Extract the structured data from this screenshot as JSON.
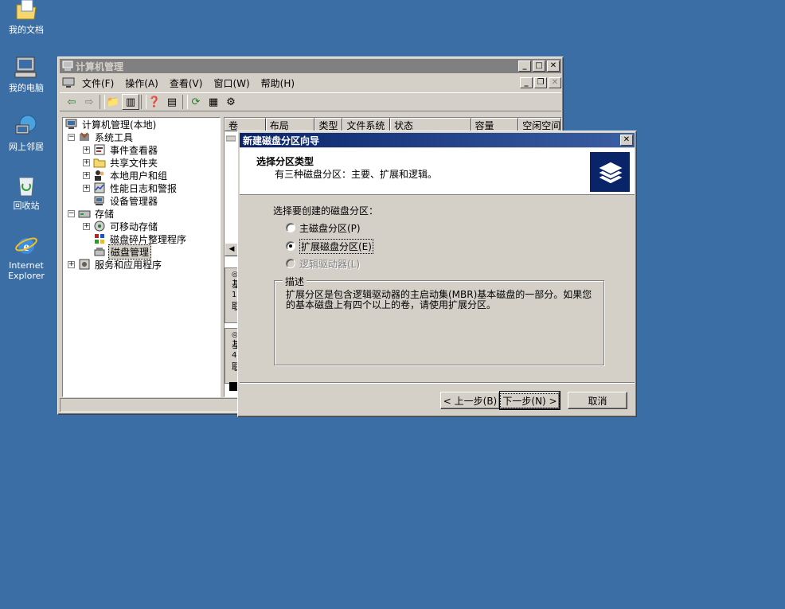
{
  "desktop": {
    "icons": [
      {
        "label": "我的文档",
        "icon": "my-documents-icon"
      },
      {
        "label": "我的电脑",
        "icon": "my-computer-icon"
      },
      {
        "label": "网上邻居",
        "icon": "network-places-icon"
      },
      {
        "label": "回收站",
        "icon": "recycle-bin-icon"
      },
      {
        "label": "Internet\nExplorer",
        "icon": "internet-explorer-icon"
      }
    ]
  },
  "computer_management": {
    "title": "计算机管理",
    "menu": [
      "文件(F)",
      "操作(A)",
      "查看(V)",
      "窗口(W)",
      "帮助(H)"
    ],
    "tree": {
      "root": "计算机管理(本地)",
      "system_tools": "系统工具",
      "event_viewer": "事件查看器",
      "shared_folders": "共享文件夹",
      "local_users": "本地用户和组",
      "perf_logs": "性能日志和警报",
      "device_manager": "设备管理器",
      "storage": "存储",
      "removable_storage": "可移动存储",
      "defrag": "磁盘碎片整理程序",
      "disk_management": "磁盘管理",
      "services_apps": "服务和应用程序"
    },
    "columns": [
      "卷",
      "布局",
      "类型",
      "文件系统",
      "状态",
      "容量",
      "空闲空间"
    ],
    "disk_rows": [
      {
        "line1": "基",
        "line2": "1·",
        "line3": "联"
      },
      {
        "line1": "基",
        "line2": "4",
        "line3": "联"
      }
    ]
  },
  "wizard": {
    "title": "新建磁盘分区向导",
    "header_title": "选择分区类型",
    "header_subtitle": "有三种磁盘分区：主要、扩展和逻辑。",
    "prompt": "选择要创建的磁盘分区：",
    "options": [
      {
        "label": "主磁盘分区(P)",
        "selected": false,
        "disabled": false
      },
      {
        "label": "扩展磁盘分区(E)",
        "selected": true,
        "disabled": false
      },
      {
        "label": "逻辑驱动器(L)",
        "selected": false,
        "disabled": true
      }
    ],
    "group_title": "描述",
    "description": "扩展分区是包含逻辑驱动器的主启动集(MBR)基本磁盘的一部分。如果您的基本磁盘上有四个以上的卷，请使用扩展分区。",
    "back_label": "< 上一步(B)",
    "next_label": "下一步(N) >",
    "cancel_label": "取消"
  }
}
